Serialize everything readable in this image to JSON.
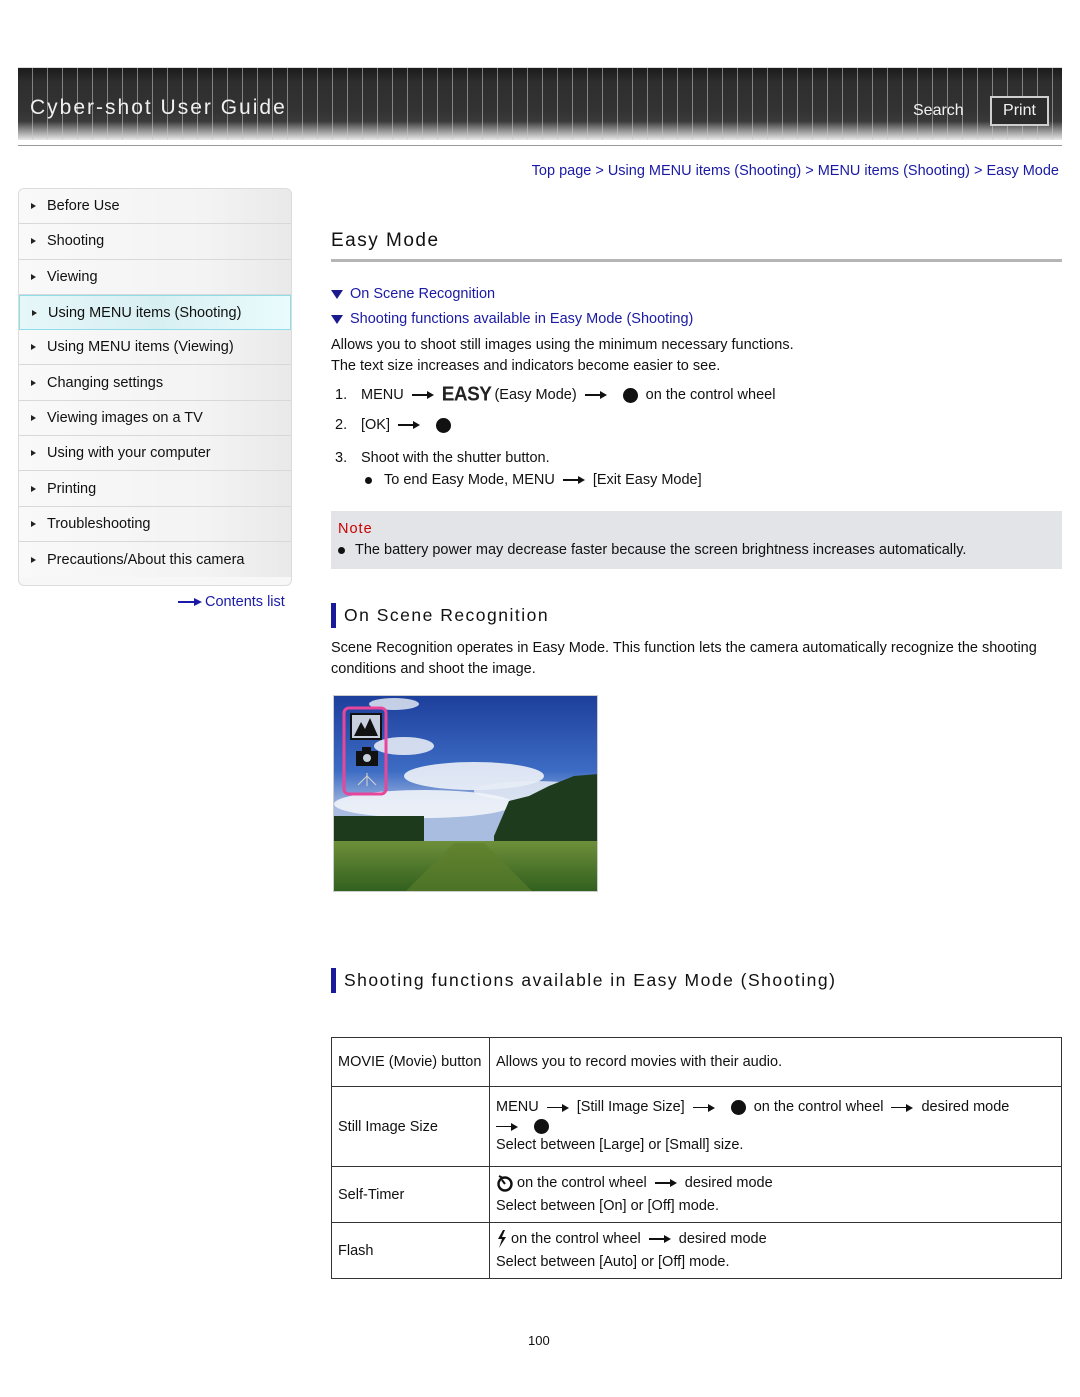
{
  "header": {
    "app_title": "Cyber-shot User Guide",
    "search_label": "Search",
    "print_label": "Print"
  },
  "breadcrumb": [
    {
      "label": "Top page"
    },
    {
      "label": "Using MENU items (Shooting)"
    },
    {
      "label": "MENU items (Shooting)"
    },
    {
      "label": "Easy Mode"
    }
  ],
  "breadcrumb_separator": ">",
  "sidebar": {
    "items": [
      {
        "label": "Before Use",
        "active": false
      },
      {
        "label": "Shooting",
        "active": false
      },
      {
        "label": "Viewing",
        "active": false
      },
      {
        "label": "Using MENU items (Shooting)",
        "active": true
      },
      {
        "label": "Using MENU items (Viewing)",
        "active": false
      },
      {
        "label": "Changing settings",
        "active": false
      },
      {
        "label": "Viewing images on a TV",
        "active": false
      },
      {
        "label": "Using with your computer",
        "active": false
      },
      {
        "label": "Printing",
        "active": false
      },
      {
        "label": "Troubleshooting",
        "active": false
      },
      {
        "label": "Precautions/About this camera",
        "active": false
      }
    ],
    "contents_link": "Contents list"
  },
  "main": {
    "title": "Easy Mode",
    "anchor_links": [
      "On Scene Recognition",
      "Shooting functions available in Easy Mode (Shooting)"
    ],
    "intro": [
      "Allows you to shoot still images using the minimum necessary functions.",
      "The text size increases and indicators become easier to see."
    ],
    "steps": {
      "s1": {
        "num": "1.",
        "menu": "MENU",
        "icon_text": "EASY",
        "mode": "(Easy Mode)",
        "tail": "on the control wheel"
      },
      "s2": {
        "num": "2.",
        "text": "[OK]"
      },
      "s3": {
        "num": "3.",
        "text": "Shoot with the shutter button."
      },
      "sub": {
        "text": "To end Easy Mode, MENU",
        "tail": "[Exit Easy Mode]"
      }
    },
    "note": {
      "title": "Note",
      "text": "The battery power may decrease faster because the screen brightness increases automatically."
    },
    "scene_section": {
      "heading": "On Scene Recognition",
      "body": "Scene Recognition operates in Easy Mode. This function lets the camera automatically recognize the shooting conditions and shoot the image."
    },
    "functions_section": {
      "heading": "Shooting functions available in Easy Mode (Shooting)",
      "rows": {
        "movie": {
          "name": "MOVIE (Movie) button",
          "desc": "Allows you to record movies with their audio."
        },
        "still": {
          "name": "Still Image Size",
          "menu": "MENU",
          "item": "[Still Image Size]",
          "wheel": "on the control wheel",
          "mode": "desired mode",
          "select": "Select between [Large] or [Small] size."
        },
        "timer": {
          "name": "Self-Timer",
          "wheel": "on the control wheel",
          "mode": "desired mode",
          "select": "Select between [On] or [Off] mode."
        },
        "flash": {
          "name": "Flash",
          "wheel": "on the control wheel",
          "mode": "desired mode",
          "select": "Select between [Auto] or [Off] mode."
        }
      }
    },
    "page_number": "100"
  },
  "colors": {
    "link": "#1a1aa6",
    "note_title": "#cc0000",
    "note_bg": "#e2e4e8",
    "section_bar": "#1a1a9a",
    "active_nav_bg": "#d8eff2",
    "scene_frame": "#e8469a"
  }
}
